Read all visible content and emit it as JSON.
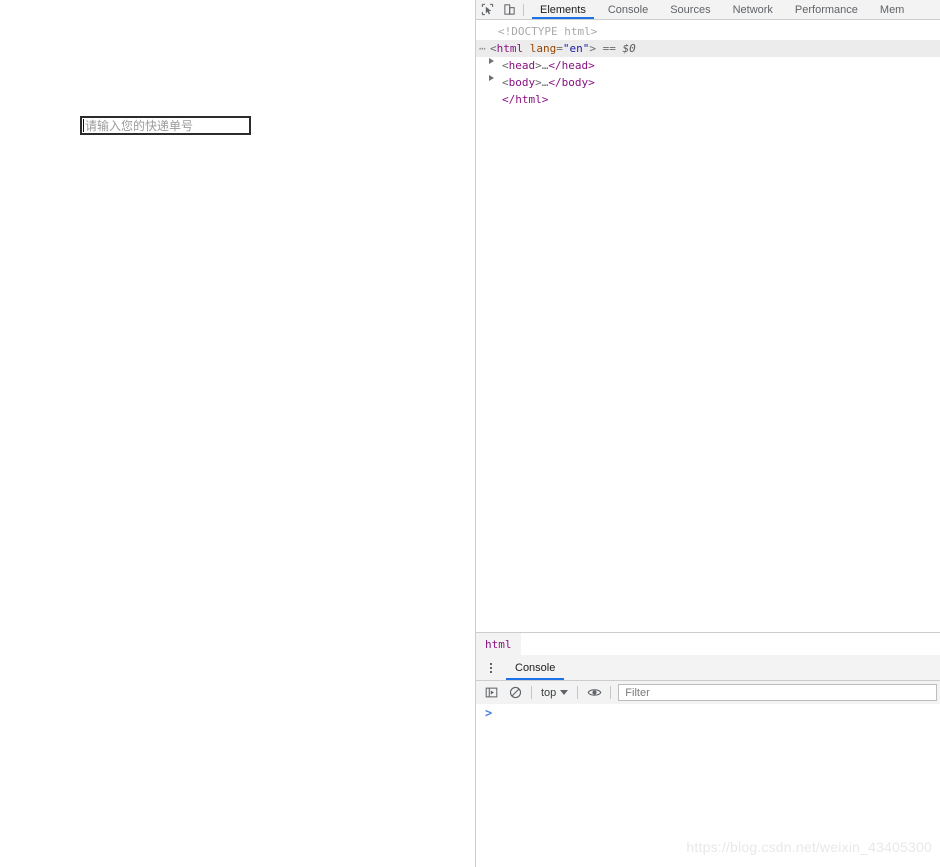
{
  "page": {
    "input": {
      "placeholder": "请输入您的快递单号",
      "value": ""
    }
  },
  "devtools": {
    "toolbar": {
      "inspect_icon": "inspect-element-icon",
      "device_icon": "device-toolbar-icon",
      "tabs": [
        {
          "label": "Elements",
          "active": true
        },
        {
          "label": "Console",
          "active": false
        },
        {
          "label": "Sources",
          "active": false
        },
        {
          "label": "Network",
          "active": false
        },
        {
          "label": "Performance",
          "active": false
        },
        {
          "label": "Mem",
          "active": false
        }
      ]
    },
    "dom_tree": {
      "rows": [
        {
          "kind": "doctype",
          "text": "<!DOCTYPE html>",
          "selected": false,
          "indent": 1
        },
        {
          "kind": "element-open",
          "selected": true,
          "indent": 0,
          "ellipsis": "⋯",
          "open_lt": "<",
          "tag": "html",
          "attr_name": "lang",
          "attr_eq": "=",
          "attr_value": "\"en\"",
          "open_gt": ">",
          "suffix_eq": "==",
          "suffix_var": "$0"
        },
        {
          "kind": "collapsed",
          "selected": false,
          "indent": 2,
          "triangle": true,
          "open_lt": "<",
          "tag": "head",
          "open_gt": ">",
          "dots": "…",
          "close": "</head>"
        },
        {
          "kind": "collapsed",
          "selected": false,
          "indent": 2,
          "triangle": true,
          "open_lt": "<",
          "tag": "body",
          "open_gt": ">",
          "dots": "…",
          "close": "</body>"
        },
        {
          "kind": "element-close",
          "selected": false,
          "indent": 2,
          "close": "</html>"
        }
      ]
    },
    "breadcrumb": {
      "items": [
        {
          "label": "html",
          "active": true
        }
      ]
    },
    "drawer": {
      "menu_icon": "more-options-kebab-icon",
      "tabs": [
        {
          "label": "Console",
          "active": true
        }
      ],
      "toolbar": {
        "sidebar_icon": "console-sidebar-toggle-icon",
        "clear_icon": "clear-console-icon",
        "context_value": "top",
        "eye_icon": "live-expression-eye-icon",
        "filter_placeholder": "Filter",
        "filter_value": ""
      },
      "prompt": ">"
    }
  },
  "watermark": {
    "text": "https://blog.csdn.net/weixin_43405300"
  },
  "colors": {
    "accent_blue": "#1a73e8",
    "toolbar_bg": "#f3f3f3",
    "border": "#cdcdcd",
    "tag_purple": "#881280",
    "attr_orange": "#994500",
    "value_blue": "#1a1aa6"
  }
}
